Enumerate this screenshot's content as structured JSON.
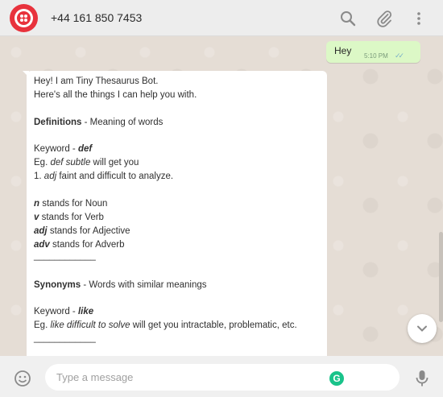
{
  "header": {
    "contact": "+44 161 850 7453",
    "icons": [
      "twilio-logo-icon",
      "search-icon",
      "attach-icon",
      "more-vert-icon"
    ]
  },
  "messages": {
    "outgoing": {
      "text": "Hey",
      "time": "5:10 PM",
      "ticks": "✓✓"
    },
    "incoming": {
      "intro1": "Hey! I am Tiny Thesaurus Bot.",
      "intro2": "Here's all the things I can help you with.",
      "def_title": "Definitions",
      "def_desc": " - Meaning of words",
      "keyword_label": "Keyword - ",
      "def_keyword": "def",
      "def_eg_prefix": "Eg. ",
      "def_eg_italic": "def subtle",
      "def_eg_suffix": " will get you",
      "def_result_prefix": "1. ",
      "def_result_italic": "adj",
      "def_result_suffix": " faint and difficult to analyze.",
      "pos_n": "n",
      "pos_n_text": " stands for Noun",
      "pos_v": "v",
      "pos_v_text": " stands for Verb",
      "pos_adj": "adj",
      "pos_adj_text": " stands for Adjective",
      "pos_adv": "adv",
      "pos_adv_text": " stands for Adverb",
      "divider": "____________",
      "syn_title": "Synonyms",
      "syn_desc": " - Words with similar meanings",
      "syn_keyword": "like",
      "syn_eg_italic": "like difficult to solve",
      "syn_eg_suffix": "  will get you intractable, problematic, etc."
    }
  },
  "footer": {
    "placeholder": "Type a message",
    "grammarly": "G"
  }
}
